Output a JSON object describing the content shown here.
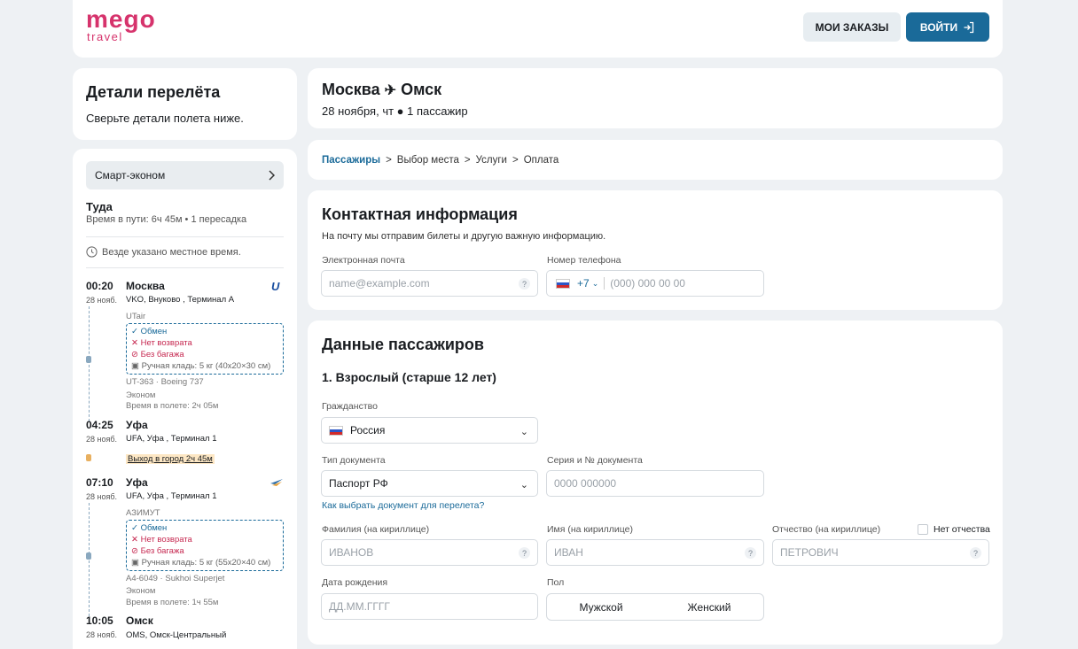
{
  "header": {
    "logo_main": "mego",
    "logo_sub": "travel",
    "orders_label": "МОИ ЗАКАЗЫ",
    "login_label": "ВОЙТИ"
  },
  "sidebar": {
    "title": "Детали перелёта",
    "subtitle": "Сверьте детали полета ниже.",
    "fare": "Смарт-эконом",
    "direction": "Туда",
    "travel_time": "Время в пути: 6ч 45м • 1 пересадка",
    "local_time_note": "Везде указано местное время.",
    "segments": [
      {
        "dep_time": "00:20",
        "dep_date": "28 нояб.",
        "dep_city": "Москва",
        "dep_airport": "VKO, Внуково , Терминал A",
        "airline": "UTair",
        "exchange": "Обмен",
        "refund": "Нет возврата",
        "baggage": "Без багажа",
        "hand_luggage": "Ручная кладь: 5 кг (40x20×30 см)",
        "flight": "UT-363 · Boeing 737",
        "class": "Эконом",
        "duration": "Время в полете: 2ч 05м",
        "arr_time": "04:25",
        "arr_date": "28 нояб.",
        "arr_city": "Уфа",
        "arr_airport": "UFA, Уфа , Терминал 1"
      },
      {
        "dep_time": "07:10",
        "dep_date": "28 нояб.",
        "dep_city": "Уфа",
        "dep_airport": "UFA, Уфа , Терминал 1",
        "airline": "АЗИМУТ",
        "exchange": "Обмен",
        "refund": "Нет возврата",
        "baggage": "Без багажа",
        "hand_luggage": "Ручная кладь: 5 кг (55x20×40 см)",
        "flight": "A4-6049 · Sukhoi Superjet",
        "class": "Эконом",
        "duration": "Время в полете: 1ч 55м",
        "arr_time": "10:05",
        "arr_date": "28 нояб.",
        "arr_city": "Омск",
        "arr_airport": "OMS, Омск-Центральный"
      }
    ],
    "transfer": "Выход в город 2ч 45м"
  },
  "route": {
    "from": "Москва",
    "to": "Омск",
    "info": "28 ноября, чт ● 1 пассажир"
  },
  "steps": [
    "Пассажиры",
    "Выбор места",
    "Услуги",
    "Оплата"
  ],
  "contact": {
    "title": "Контактная информация",
    "subtitle": "На почту мы отправим билеты и другую важную информацию.",
    "email_label": "Электронная почта",
    "email_placeholder": "name@example.com",
    "phone_label": "Номер телефона",
    "phone_code": "+7",
    "phone_placeholder": "(000) 000 00 00"
  },
  "passengers": {
    "title": "Данные пассажиров",
    "passenger_title": "1. Взрослый (старше 12 лет)",
    "citizenship_label": "Гражданство",
    "citizenship_value": "Россия",
    "doc_type_label": "Тип документа",
    "doc_type_value": "Паспорт РФ",
    "doc_number_label": "Серия и № документа",
    "doc_number_placeholder": "0000 000000",
    "doc_help_link": "Как выбрать документ для перелета?",
    "surname_label": "Фамилия (на кириллице)",
    "surname_placeholder": "ИВАНОВ",
    "name_label": "Имя (на кириллице)",
    "name_placeholder": "ИВАН",
    "patronymic_label": "Отчество (на кириллице)",
    "patronymic_placeholder": "ПЕТРОВИЧ",
    "no_patronymic": "Нет отчества",
    "birth_label": "Дата рождения",
    "birth_placeholder": "ДД.ММ.ГГГГ",
    "gender_label": "Пол",
    "gender_male": "Мужской",
    "gender_female": "Женский"
  }
}
